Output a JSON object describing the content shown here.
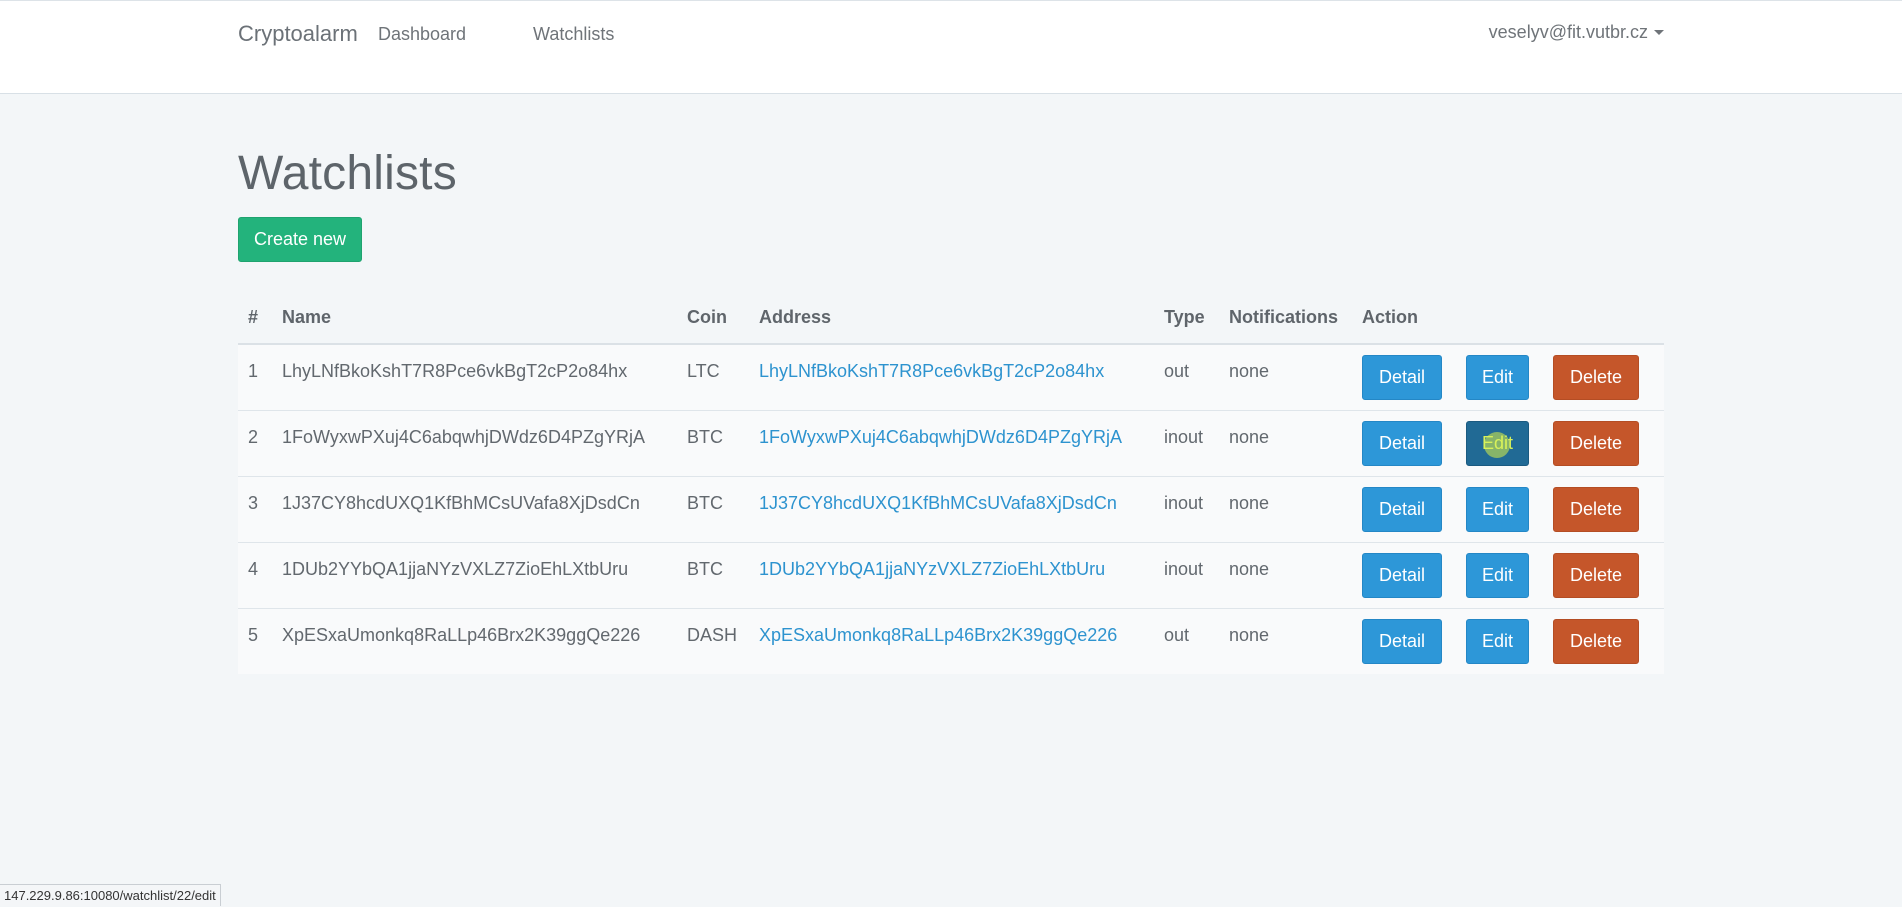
{
  "navbar": {
    "brand": "Cryptoalarm",
    "links": [
      "Dashboard",
      "Watchlists"
    ],
    "user": "veselyv@fit.vutbr.cz",
    "user_icon": "caret-down-icon"
  },
  "page": {
    "title": "Watchlists",
    "create_label": "Create new"
  },
  "table": {
    "headers": [
      "#",
      "Name",
      "Coin",
      "Address",
      "Type",
      "Notifications",
      "Action"
    ],
    "rows": [
      {
        "num": "1",
        "name": "LhyLNfBkoKshT7R8Pce6vkBgT2cP2o84hx",
        "coin": "LTC",
        "address": "LhyLNfBkoKshT7R8Pce6vkBgT2cP2o84hx",
        "type": "out",
        "notifications": "none"
      },
      {
        "num": "2",
        "name": "1FoWyxwPXuj4C6abqwhjDWdz6D4PZgYRjA",
        "coin": "BTC",
        "address": "1FoWyxwPXuj4C6abqwhjDWdz6D4PZgYRjA",
        "type": "inout",
        "notifications": "none"
      },
      {
        "num": "3",
        "name": "1J37CY8hcdUXQ1KfBhMCsUVafa8XjDsdCn",
        "coin": "BTC",
        "address": "1J37CY8hcdUXQ1KfBhMCsUVafa8XjDsdCn",
        "type": "inout",
        "notifications": "none"
      },
      {
        "num": "4",
        "name": "1DUb2YYbQA1jjaNYzVXLZ7ZioEhLXtbUru",
        "coin": "BTC",
        "address": "1DUb2YYbQA1jjaNYzVXLZ7ZioEhLXtbUru",
        "type": "inout",
        "notifications": "none"
      },
      {
        "num": "5",
        "name": "XpESxaUmonkq8RaLLp46Brx2K39ggQe226",
        "coin": "DASH",
        "address": "XpESxaUmonkq8RaLLp46Brx2K39ggQe226",
        "type": "out",
        "notifications": "none"
      }
    ],
    "actions": {
      "detail": "Detail",
      "edit": "Edit",
      "delete": "Delete"
    }
  },
  "status_bar": {
    "url": "147.229.9.86:10080/watchlist/22/edit"
  },
  "colors": {
    "create": "#23b37c",
    "primary": "#2d97d8",
    "primary_active": "#216a95",
    "danger": "#c5562a",
    "link": "#2d93cf"
  }
}
